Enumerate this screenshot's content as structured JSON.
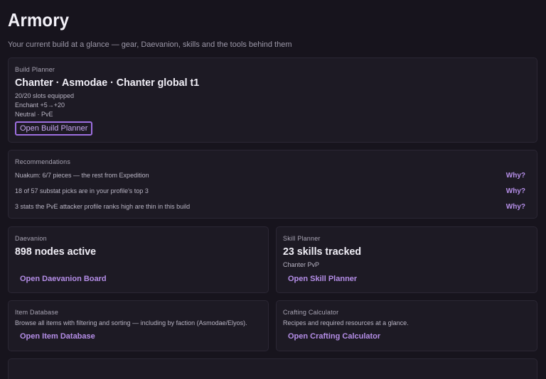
{
  "page": {
    "title": "Armory",
    "subtitle": "Your current build at a glance — gear, Daevanion, skills and the tools behind them"
  },
  "build_planner": {
    "label": "Build Planner",
    "heading": "Chanter · Asmodae · Chanter global t1",
    "slots": "20/20 slots equipped",
    "enchant": "Enchant +5→+20",
    "mode": "Neutral · PvE",
    "button": "Open Build Planner"
  },
  "recommendations": {
    "label": "Recommendations",
    "items": [
      {
        "text": "Nuakum: 6/7 pieces — the rest from Expedition",
        "action": "Why?"
      },
      {
        "text": "18 of 57 substat picks are in your profile's top 3",
        "action": "Why?"
      },
      {
        "text": "3 stats the PvE attacker profile ranks high are thin in this build",
        "action": "Why?"
      }
    ]
  },
  "daevanion": {
    "label": "Daevanion",
    "heading": "898 nodes active",
    "link": "Open Daevanion Board"
  },
  "skill_planner": {
    "label": "Skill Planner",
    "heading": "23 skills tracked",
    "sub": "Chanter PvP",
    "link": "Open Skill Planner"
  },
  "item_database": {
    "label": "Item Database",
    "description": "Browse all items with filtering and sorting — including by faction (Asmodae/Elyos).",
    "link": "Open Item Database"
  },
  "crafting_calculator": {
    "label": "Crafting Calculator",
    "description": "Recipes and required resources at a glance.",
    "link": "Open Crafting Calculator"
  },
  "colors": {
    "background": "#17141d",
    "card": "#1d1a24",
    "accent": "#b58ee8"
  }
}
